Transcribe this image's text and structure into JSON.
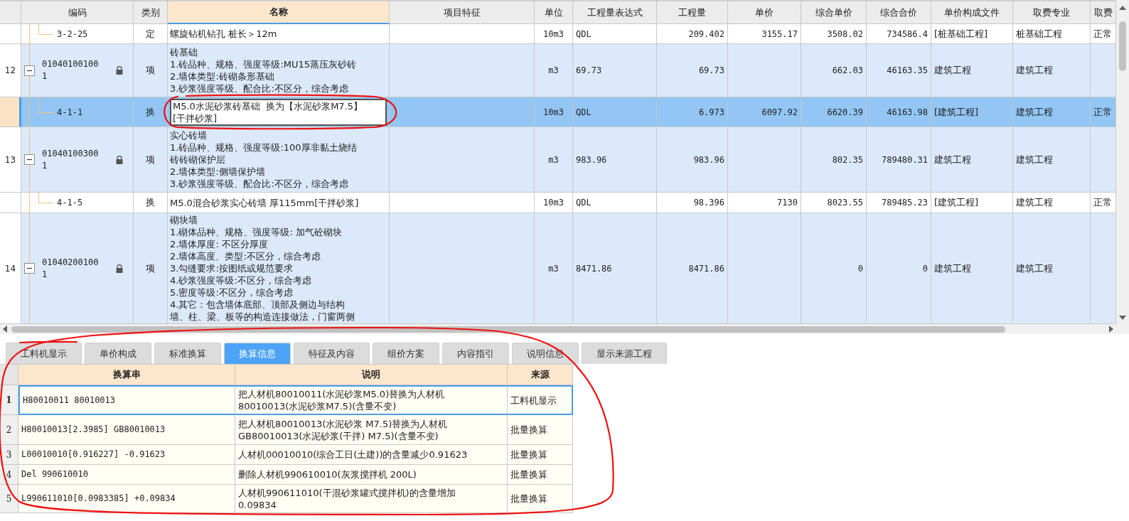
{
  "grid": {
    "columns": [
      {
        "label": "编码",
        "selected": false
      },
      {
        "label": "类别",
        "selected": false
      },
      {
        "label": "名称",
        "selected": true
      },
      {
        "label": "项目特征",
        "selected": false
      },
      {
        "label": "单位",
        "selected": false
      },
      {
        "label": "工程量表达式",
        "selected": false
      },
      {
        "label": "工程量",
        "selected": false
      },
      {
        "label": "单价",
        "selected": false
      },
      {
        "label": "综合单价",
        "selected": false
      },
      {
        "label": "综合合价",
        "selected": false
      },
      {
        "label": "单价构成文件",
        "selected": false
      },
      {
        "label": "取费专业",
        "selected": false
      },
      {
        "label": "取费",
        "selected": false
      }
    ],
    "rows": [
      {
        "kind": "sub",
        "code": "3-2-25",
        "type": "定",
        "name": [
          "螺旋钻机钻孔 桩长＞12m"
        ],
        "unit": "10m3",
        "expr": "QDL",
        "qty": "209.402",
        "price": "3155.17",
        "comp_price": "3508.02",
        "comp_total": "734586.4",
        "file": "[桩基础工程]",
        "specialty": "桩基础工程",
        "fee": "正常",
        "selected": false
      },
      {
        "kind": "item",
        "number": "12",
        "code": "010401001001",
        "locked": true,
        "expanded": true,
        "type": "项",
        "name": [
          "砖基础",
          "1.砖品种、规格、强度等级:MU15蒸压灰砂砖",
          "2.墙体类型:砖砌条形基础",
          "3.砂浆强度等级、配合比:不区分，综合考虑"
        ],
        "unit": "m3",
        "expr": "69.73",
        "qty": "69.73",
        "comp_price": "662.03",
        "comp_total": "46163.35",
        "file": "建筑工程",
        "specialty": "建筑工程",
        "selected": false,
        "children": [
          {
            "kind": "sub",
            "code": "4-1-1",
            "type": "换",
            "name": [
              "M5.0水泥砂浆砖基础  换为【水泥砂浆M7.5】",
              "[干拌砂浆]"
            ],
            "unit": "10m3",
            "expr": "QDL",
            "qty": "6.973",
            "price": "6097.92",
            "comp_price": "6620.39",
            "comp_total": "46163.98",
            "file": "[建筑工程]",
            "specialty": "建筑工程",
            "fee": "正常",
            "selected": true
          }
        ]
      },
      {
        "kind": "item",
        "number": "13",
        "code": "010401003001",
        "locked": true,
        "expanded": true,
        "type": "项",
        "name": [
          "实心砖墙",
          "1.砖品种、规格、强度等级:100厚非黏土烧结",
          "砖砖砌保护层",
          "2.墙体类型:侧墙保护墙",
          "3.砂浆强度等级、配合比:不区分，综合考虑"
        ],
        "unit": "m3",
        "expr": "983.96",
        "qty": "983.96",
        "comp_price": "802.35",
        "comp_total": "789480.31",
        "file": "建筑工程",
        "specialty": "建筑工程",
        "selected": false,
        "children": [
          {
            "kind": "sub",
            "code": "4-1-5",
            "type": "换",
            "name": [
              "M5.0混合砂浆实心砖墙 厚115mm[干拌砂浆]"
            ],
            "unit": "10m3",
            "expr": "QDL",
            "qty": "98.396",
            "price": "7130",
            "comp_price": "8023.55",
            "comp_total": "789485.23",
            "file": "[建筑工程]",
            "specialty": "建筑工程",
            "fee": "正常",
            "selected": false
          }
        ]
      },
      {
        "kind": "item",
        "number": "14",
        "code": "010402001001",
        "locked": true,
        "expanded": true,
        "type": "项",
        "name": [
          "砌块墙",
          "1.砌体品种、规格、强度等级: 加气砼砌块",
          "2.墙体厚度: 不区分厚度",
          "2.墙体高度、类型:不区分，综合考虑",
          "3.勾缝要求:按图纸或规范要求",
          "4.砂浆强度等级:不区分，综合考虑",
          "5.密度等级:不区分，综合考虑",
          "4.其它：包含墙体底部、顶部及侧边与结构",
          "墙、柱、梁、板等的构造连接做法，门窗两侧"
        ],
        "unit": "m3",
        "expr": "8471.86",
        "qty": "8471.86",
        "comp_price": "0",
        "comp_total": "0",
        "file": "建筑工程",
        "specialty": "建筑工程",
        "selected": false
      }
    ]
  },
  "tabs": [
    {
      "label": "工料机显示",
      "selected": false
    },
    {
      "label": "单价构成",
      "selected": false
    },
    {
      "label": "标准换算",
      "selected": false
    },
    {
      "label": "换算信息",
      "selected": true
    },
    {
      "label": "特征及内容",
      "selected": false
    },
    {
      "label": "组价方案",
      "selected": false
    },
    {
      "label": "内容指引",
      "selected": false
    },
    {
      "label": "说明信息",
      "selected": false
    },
    {
      "label": "显示来源工程",
      "selected": false
    }
  ],
  "detail_table": {
    "columns": [
      "换算串",
      "说明",
      "来源"
    ],
    "rows": [
      {
        "number": "1",
        "expr": "H80010011 80010013",
        "desc": "把人材机80010011(水泥砂浆M5.0)替换为人材机\n80010013(水泥砂浆M7.5)(含量不变)",
        "source": "工料机显示",
        "selected": true
      },
      {
        "number": "2",
        "expr": "H80010013[2.3985] GB80010013",
        "desc": "把人材机80010013(水泥砂浆 M7.5)替换为人材机\nGB80010013(水泥砂浆(干拌) M7.5)(含量不变)",
        "source": "批量换算",
        "selected": false
      },
      {
        "number": "3",
        "expr": "L00010010[0.916227] -0.91623",
        "desc": "人材机00010010(综合工日(土建))的含量减少0.91623",
        "source": "批量换算",
        "selected": false
      },
      {
        "number": "4",
        "expr": "Del 990610010",
        "desc": "删除人材机990610010(灰浆搅拌机 200L)",
        "source": "批量换算",
        "selected": false
      },
      {
        "number": "5",
        "expr": "L990611010[0.0983385] +0.09834",
        "desc": "人材机990611010(干混砂浆罐式搅拌机)的含量增加\n0.09834",
        "source": "批量换算",
        "selected": false
      }
    ]
  },
  "annotations": [
    {
      "kind": "ellipse"
    },
    {
      "kind": "loop"
    },
    {
      "kind": "stroke"
    }
  ]
}
